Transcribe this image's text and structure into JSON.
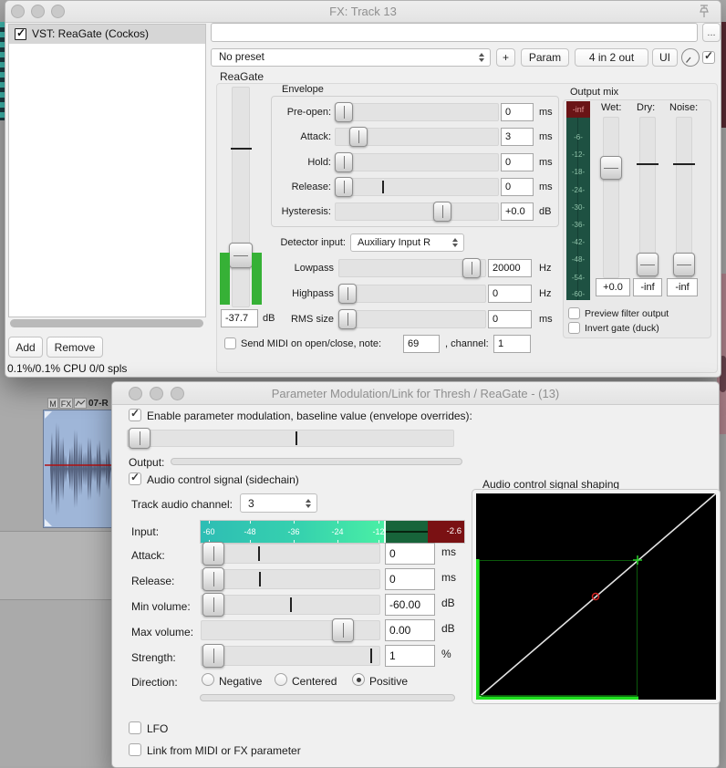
{
  "colors": {
    "accent_green": "#36b136",
    "meter_scale_green": "#1e5142",
    "meter_peak_red": "#6a1416",
    "input_meter_red": "#7a1113",
    "item_blue": "#9fb6d8",
    "graph_green": "#1ee01e"
  },
  "fx": {
    "title": "FX: Track 13",
    "list": {
      "item": "VST: ReaGate (Cockos)"
    },
    "buttons": {
      "add": "Add",
      "remove": "Remove",
      "dots": "...",
      "plus": "+",
      "param": "Param",
      "io": "4 in 2 out",
      "ui": "UI"
    },
    "preset": "No preset",
    "cpu": "0.1%/0.1% CPU 0/0 spls",
    "plugin": "ReaGate",
    "threshold": {
      "value": "-37.7",
      "unit": "dB"
    },
    "envelope": {
      "title": "Envelope",
      "rows": [
        {
          "label": "Pre-open:",
          "value": "0",
          "unit": "ms"
        },
        {
          "label": "Attack:",
          "value": "3",
          "unit": "ms"
        },
        {
          "label": "Hold:",
          "value": "0",
          "unit": "ms"
        },
        {
          "label": "Release:",
          "value": "0",
          "unit": "ms"
        },
        {
          "label": "Hysteresis:",
          "value": "+0.0",
          "unit": "dB"
        }
      ]
    },
    "detector": {
      "label": "Detector input:",
      "value": "Auxiliary Input R"
    },
    "filters": [
      {
        "label": "Lowpass",
        "value": "20000",
        "unit": "Hz"
      },
      {
        "label": "Highpass",
        "value": "0",
        "unit": "Hz"
      },
      {
        "label": "RMS size",
        "value": "0",
        "unit": "ms"
      }
    ],
    "midi": {
      "label": "Send MIDI on open/close, note:",
      "note": "69",
      "channel_label": ", channel:",
      "channel": "1"
    },
    "out": {
      "title": "Output mix",
      "peak": "-inf",
      "scale_ticks": [
        "-6-",
        "-12-",
        "-18-",
        "-24-",
        "-30-",
        "-36-",
        "-42-",
        "-48-",
        "-54-",
        "-60-"
      ],
      "wet": {
        "label": "Wet:",
        "value": "+0.0"
      },
      "dry": {
        "label": "Dry:",
        "value": "-inf"
      },
      "noise": {
        "label": "Noise:",
        "value": "-inf"
      },
      "preview": "Preview filter output",
      "invert": "Invert gate (duck)"
    }
  },
  "mod": {
    "title": "Parameter Modulation/Link for Thresh / ReaGate - (13)",
    "enable": "Enable parameter modulation, baseline value (envelope overrides):",
    "output": "Output:",
    "sidechain": "Audio control signal (sidechain)",
    "channel": {
      "label": "Track audio channel:",
      "value": "3"
    },
    "input": {
      "label": "Input:",
      "ticks": [
        "-60",
        "-48",
        "-36",
        "-24",
        "-12"
      ],
      "peak": "-2.6"
    },
    "rows": [
      {
        "label": "Attack:",
        "value": "0",
        "unit": "ms"
      },
      {
        "label": "Release:",
        "value": "0",
        "unit": "ms"
      },
      {
        "label": "Min volume:",
        "value": "-60.00",
        "unit": "dB"
      },
      {
        "label": "Max volume:",
        "value": "0.00",
        "unit": "dB"
      },
      {
        "label": "Strength:",
        "value": "1",
        "unit": "%"
      }
    ],
    "direction": {
      "label": "Direction:",
      "options": [
        "Negative",
        "Centered",
        "Positive"
      ],
      "selected": "Positive"
    },
    "shaping": "Audio control signal shaping",
    "lfo": "LFO",
    "link": "Link from MIDI or FX parameter"
  },
  "bg": {
    "item": {
      "mute": "M",
      "fx": "FX",
      "name": "07-R"
    }
  }
}
